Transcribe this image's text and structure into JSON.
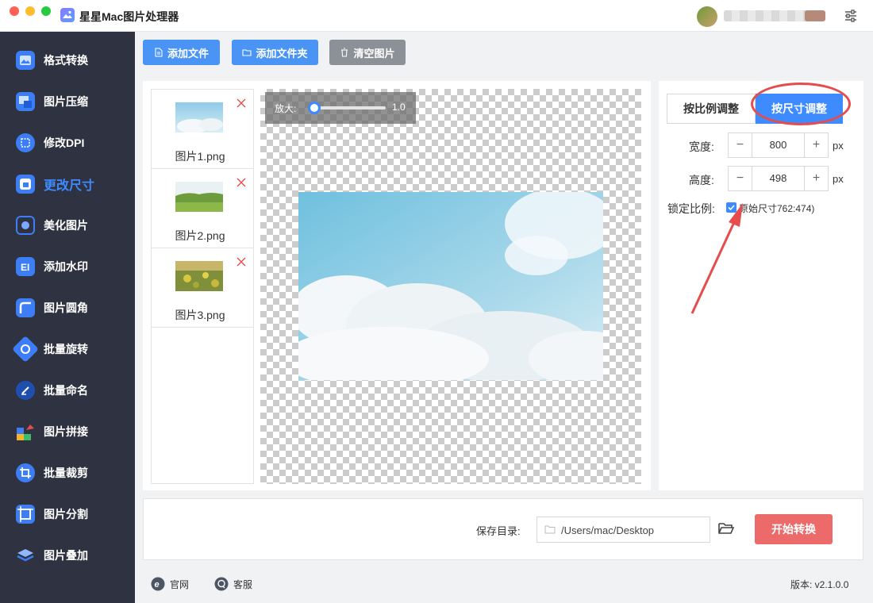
{
  "app": {
    "title": "星星Mac图片处理器"
  },
  "sidebar": {
    "items": [
      {
        "label": "格式转换",
        "icon": "format-icon"
      },
      {
        "label": "图片压缩",
        "icon": "compress-icon"
      },
      {
        "label": "修改DPI",
        "icon": "dpi-icon"
      },
      {
        "label": "更改尺寸",
        "icon": "resize-icon",
        "active": true
      },
      {
        "label": "美化图片",
        "icon": "beautify-icon"
      },
      {
        "label": "添加水印",
        "icon": "watermark-icon"
      },
      {
        "label": "图片圆角",
        "icon": "round-corner-icon"
      },
      {
        "label": "批量旋转",
        "icon": "rotate-icon"
      },
      {
        "label": "批量命名",
        "icon": "rename-icon"
      },
      {
        "label": "图片拼接",
        "icon": "stitch-icon"
      },
      {
        "label": "批量裁剪",
        "icon": "crop-icon"
      },
      {
        "label": "图片分割",
        "icon": "split-icon"
      },
      {
        "label": "图片叠加",
        "icon": "overlay-icon"
      }
    ]
  },
  "toolbar": {
    "add_file": "添加文件",
    "add_folder": "添加文件夹",
    "clear": "清空图片"
  },
  "files": [
    {
      "name": "图片1.png"
    },
    {
      "name": "图片2.png"
    },
    {
      "name": "图片3.png"
    }
  ],
  "zoom": {
    "label": "放大:",
    "value": "1.0",
    "level": 0.0
  },
  "resize": {
    "tab_ratio": "按比例调整",
    "tab_size": "按尺寸调整",
    "width_label": "宽度:",
    "width_value": "800",
    "height_label": "高度:",
    "height_value": "498",
    "unit": "px",
    "lock_label": "锁定比例:",
    "lock_note": "原始尺寸762:474)",
    "lock_checked": true
  },
  "bottom": {
    "save_label": "保存目录:",
    "save_path": "/Users/mac/Desktop",
    "start_button": "开始转换"
  },
  "footer": {
    "website": "官网",
    "support": "客服",
    "version": "版本:  v2.1.0.0"
  },
  "colors": {
    "accent": "#3d8bff",
    "sidebar_bg": "#2f3240",
    "start_button": "#ec6a6a",
    "annotation": "#e74c4c"
  }
}
